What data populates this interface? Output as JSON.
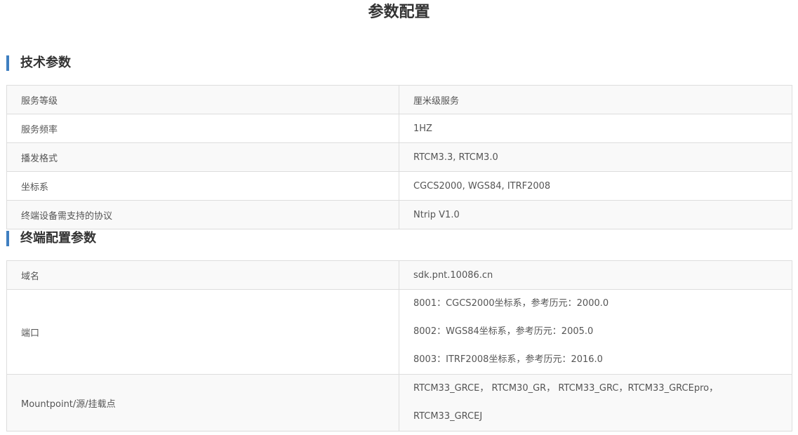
{
  "page": {
    "title": "参数配置"
  },
  "tech_params": {
    "heading": "技术参数",
    "rows": [
      {
        "key": "服务等级",
        "value": "厘米级服务"
      },
      {
        "key": "服务频率",
        "value": "1HZ"
      },
      {
        "key": "播发格式",
        "value": "RTCM3.3, RTCM3.0"
      },
      {
        "key": "坐标系",
        "value": "CGCS2000, WGS84, ITRF2008"
      },
      {
        "key": "终端设备需支持的协议",
        "value": "Ntrip V1.0"
      }
    ]
  },
  "terminal_params": {
    "heading": "终端配置参数",
    "domain": {
      "key": "域名",
      "value": "sdk.pnt.10086.cn"
    },
    "port": {
      "key": "端口",
      "lines": [
        "8001：CGCS2000坐标系，参考历元：2000.0",
        "8002：WGS84坐标系，参考历元：2005.0",
        "8003：ITRF2008坐标系，参考历元：2016.0"
      ]
    },
    "mountpoint": {
      "key": "Mountpoint/源/挂载点",
      "lines": [
        "RTCM33_GRCE， RTCM30_GR， RTCM33_GRC，RTCM33_GRCEpro，",
        "RTCM33_GRCEJ"
      ]
    }
  }
}
